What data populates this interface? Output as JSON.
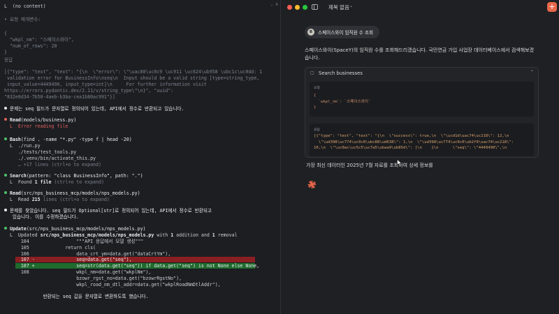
{
  "terminal": {
    "scroll_hint": "⌄ A⁠",
    "lines": {
      "l1": "L  (no content)",
      "l2": "• 요청 매개변수:",
      "l3": "{",
      "l4": "  \"wkpl_nm\": \"스페이스와이\",",
      "l5": "  \"num_of_rows\": 20",
      "l6": "}",
      "l7": "응답",
      "l8": "[{\"type\": \"text\", \"text\": \"{\\n  \\\"error\\\": \\\"\\uac80\\uc0c9 \\uc911 \\uc624\\ub958 \\ubc1c\\uc0dd: 1",
      "l9": " validation error for BusinessInfo\\nseq\\n  Input should be a valid string [type=string_type,",
      " l10": "",
      "l10": " input_value=4449490, input_type=int]\\n     For further information visit",
      "l11": "https://errors.pydantic.dev/2.11/v/string_type\\\"\\n}\", \"uuid\":",
      "l12": "\"832e8d34-7b50-4aeb-b3ba-cea1b80ac991\"}]",
      "l13": "문제는 seq 필드가 문자열로 정의되어 있는데, API에서 정수로 반환되고 있습니다.",
      "l14a": "Read",
      "l14b": "(models/business.py)",
      "l15": "  L  Error reading file",
      "l16a": "Bash",
      "l16b": "(find . -name \"*.py\" -type f | head -20)",
      "l17": "  L  ./run.py",
      "l18": "     ./tests/test_tools.py",
      "l19": "     ./.venv/bin/activate_this.py",
      "l20": "     … +17 lines (ctrl+o to expand)",
      "l21a": "Search",
      "l21b": "(pattern: \"class BusinessInfo\", path: \".\")",
      "l22a": "  L  Found ",
      "l22b": "1 file",
      "l22c": " (ctrl+o to expand)",
      "l23a": "Read",
      "l23b": "(src/nps_business_mcp/models/nps_models.py)",
      "l24a": "  L  Read ",
      "l24b": "215",
      "l24c": " lines (ctrl+o to expand)",
      "l25": "문제를 찾았습니다. seq 필드가 Optional[str]로 정의되어 있는데, API에서 정수로 반환되고",
      "l26": "있습니다. 이를 수정하겠습니다.",
      "l27a": "Update",
      "l27b": "(src/nps_business_mcp/models/nps_models.py)",
      "l28a": "  L  Updated ",
      "l28b": "src/nps_business_mcp/models/nps_models.py",
      "l28c": " with ",
      "l28d": "1",
      "l28e": " addition and ",
      "l28f": "1",
      "l28g": " removal",
      "d104": "      104                 \"\"\"API 응답에서 모델 생성\"\"\"",
      "d105": "      105             return cls(",
      "d106": "      106                 data_crt_ym=data.get(\"dataCrtYm\"),",
      "d107m": "      107 -               seq=data.get(\"seq\"),",
      "d107p": "      107 +               seq=str(data.get(\"seq\")) if data.get(\"seq\") is not None else None,",
      "d108": "      108                 wkpl_nm=data.get(\"wkplNm\"),",
      "d109": "                          bzowr_rgst_no=data.get(\"bzowrRgstNo\"),",
      "d110": "                          wkpl_road_nm_dtl_addr=data.get(\"wkplRoadNmDtlAddr\"),",
      "l31": "              반환되는 seq 값을 문자열로 변환하도록 했습니다."
    }
  },
  "app": {
    "title": "제목 없음",
    "new_chat_icon": "plus",
    "user_avatar_letter": "B",
    "user_message": "스페이스와이 임직원 수 조회",
    "assistant_reply_1": "스페이스와이(SpaceY)의 임직원 수를 조회해드리겠습니다. 국민연금 가입 사업장 데이터베이스에서 검색해보겠습니다.",
    "tool": {
      "name": "Search businesses",
      "request_label": "요청",
      "request_code": "{\n  `wkpl_nm`: `스페이스와이`\n}",
      "response_label": "응답",
      "response_code": "[{\"type\": \"text\", \"text\": \"{\\n  \\\"success\\\": true,\\n  \\\"\\ucd1d\\uac74\\uc218\\\": 12,\\n\n  \\\"\\ud398\\uc774\\uc9c0\\ubc88\\ud638\\\": 1,\\n  \\\"\\ud398\\uc774\\uc9c0\\ub2f9\\uac74\\uc218\\\":\n10,\\n  \\\"\\uc0ac\\uc5c5\\uc7a5\\ubaa9\\ub85d\\\": [\\n    {\\n      \\\"seq\\\": \\\"4449490\\\",\\n"
    },
    "assistant_reply_2": "가장 최신 데이터인 2025년 7월 자료를 조회하여 상세 정보를",
    "colors": {
      "accent": "#e8674a",
      "diff_removed": "#8a1f22",
      "diff_added": "#1f6b2e"
    }
  }
}
